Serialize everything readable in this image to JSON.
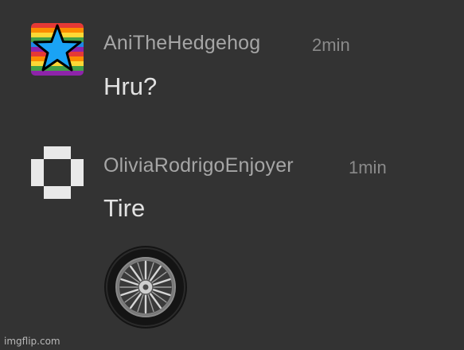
{
  "messages": [
    {
      "username": "AniTheHedgehog",
      "time": "2min",
      "text": "Hru?",
      "avatar_icon": "rainbow-star-icon"
    },
    {
      "username": "OliviaRodrigoEnjoyer",
      "time": "1min",
      "text": "Tire",
      "avatar_icon": "pixel-ring-icon",
      "attachment_icon": "tire-icon"
    }
  ],
  "watermark": "imgflip.com",
  "colors": {
    "background": "#333333",
    "username": "#a6a6a6",
    "timestamp": "#8a8a8a",
    "message_text": "#e2e2e2",
    "star": "#1aa3f5"
  }
}
